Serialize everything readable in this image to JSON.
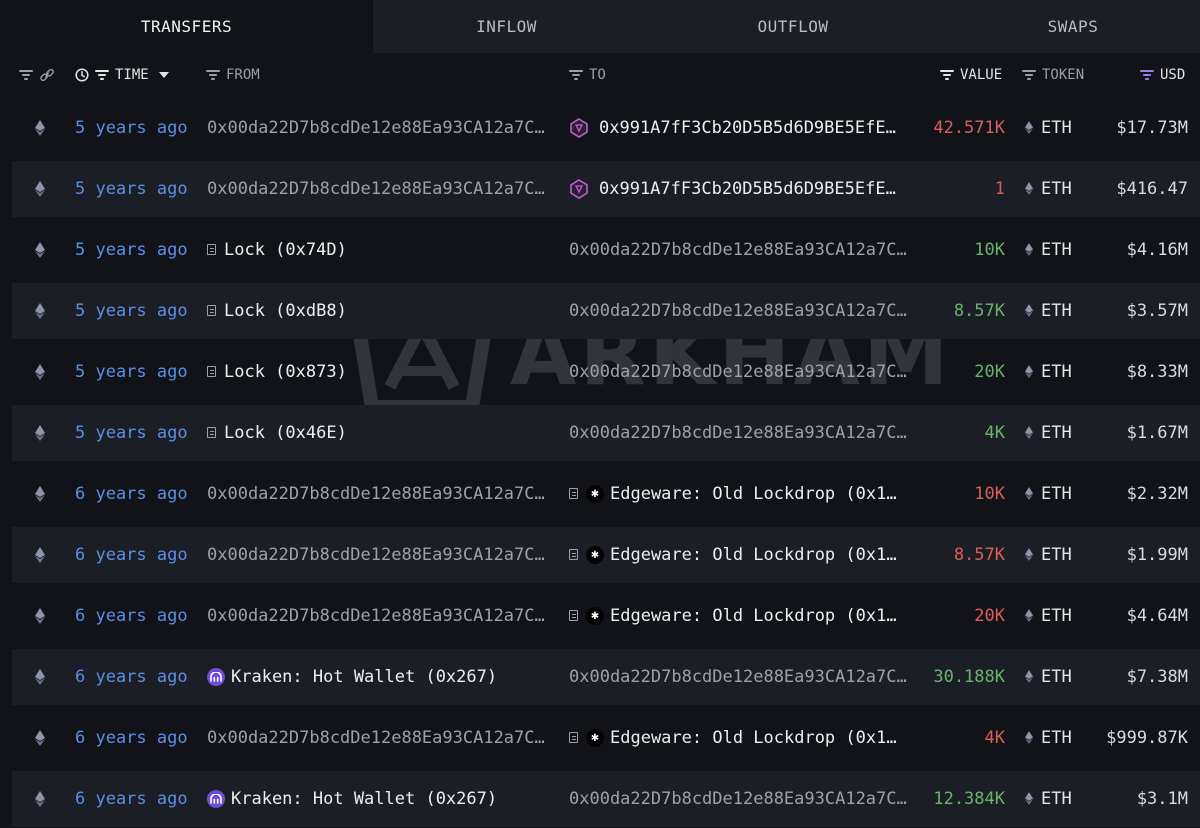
{
  "tabs": [
    {
      "label": "TRANSFERS",
      "active": true
    },
    {
      "label": "INFLOW",
      "active": false
    },
    {
      "label": "OUTFLOW",
      "active": false
    },
    {
      "label": "SWAPS",
      "active": false
    }
  ],
  "columns": {
    "time": "TIME",
    "from": "FROM",
    "to": "TO",
    "value": "VALUE",
    "token": "TOKEN",
    "usd": "USD"
  },
  "watermark": "ARKHAM",
  "colors": {
    "negative": "#d9605a",
    "positive": "#6bb36d",
    "time_link": "#5b8fe6",
    "accent": "#9b7cf2"
  },
  "rows": [
    {
      "time": "5 years ago",
      "from": "0x00da22D7b8cdDe12e88Ea93CA12a7C…",
      "to": "0x991A7fF3Cb20D5B5d6D9BE5EfE…",
      "value": "42.571K",
      "token": "ETH",
      "usd": "$17.73M"
    },
    {
      "time": "5 years ago",
      "from": "0x00da22D7b8cdDe12e88Ea93CA12a7C…",
      "to": "0x991A7fF3Cb20D5B5d6D9BE5EfE…",
      "value": "1",
      "token": "ETH",
      "usd": "$416.47"
    },
    {
      "time": "5 years ago",
      "from": "Lock (0x74D)",
      "to": "0x00da22D7b8cdDe12e88Ea93CA12a7C…",
      "value": "10K",
      "token": "ETH",
      "usd": "$4.16M"
    },
    {
      "time": "5 years ago",
      "from": "Lock (0xdB8)",
      "to": "0x00da22D7b8cdDe12e88Ea93CA12a7C…",
      "value": "8.57K",
      "token": "ETH",
      "usd": "$3.57M"
    },
    {
      "time": "5 years ago",
      "from": "Lock (0x873)",
      "to": "0x00da22D7b8cdDe12e88Ea93CA12a7C…",
      "value": "20K",
      "token": "ETH",
      "usd": "$8.33M"
    },
    {
      "time": "5 years ago",
      "from": "Lock (0x46E)",
      "to": "0x00da22D7b8cdDe12e88Ea93CA12a7C…",
      "value": "4K",
      "token": "ETH",
      "usd": "$1.67M"
    },
    {
      "time": "6 years ago",
      "from": "0x00da22D7b8cdDe12e88Ea93CA12a7C…",
      "to": "Edgeware: Old Lockdrop (0x1…",
      "value": "10K",
      "token": "ETH",
      "usd": "$2.32M"
    },
    {
      "time": "6 years ago",
      "from": "0x00da22D7b8cdDe12e88Ea93CA12a7C…",
      "to": "Edgeware: Old Lockdrop (0x1…",
      "value": "8.57K",
      "token": "ETH",
      "usd": "$1.99M"
    },
    {
      "time": "6 years ago",
      "from": "0x00da22D7b8cdDe12e88Ea93CA12a7C…",
      "to": "Edgeware: Old Lockdrop (0x1…",
      "value": "20K",
      "token": "ETH",
      "usd": "$4.64M"
    },
    {
      "time": "6 years ago",
      "from": "Kraken: Hot Wallet (0x267)",
      "to": "0x00da22D7b8cdDe12e88Ea93CA12a7C…",
      "value": "30.188K",
      "token": "ETH",
      "usd": "$7.38M"
    },
    {
      "time": "6 years ago",
      "from": "0x00da22D7b8cdDe12e88Ea93CA12a7C…",
      "to": "Edgeware: Old Lockdrop (0x1…",
      "value": "4K",
      "token": "ETH",
      "usd": "$999.87K"
    },
    {
      "time": "6 years ago",
      "from": "Kraken: Hot Wallet (0x267)",
      "to": "0x00da22D7b8cdDe12e88Ea93CA12a7C…",
      "value": "12.384K",
      "token": "ETH",
      "usd": "$3.1M"
    }
  ]
}
